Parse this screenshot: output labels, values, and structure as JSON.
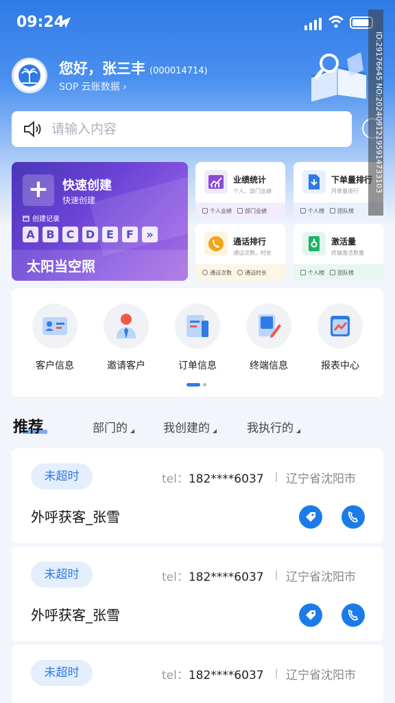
{
  "status_bar": {
    "time": "09:24"
  },
  "header": {
    "greeting": "您好，张三丰",
    "user_id": "(000014714)",
    "account_link": "SOP 云账数据 ›"
  },
  "search": {
    "placeholder": "请输入内容"
  },
  "quick_create": {
    "title": "快速创建",
    "subtitle": "快速创建",
    "record_label": "创建记录",
    "letters": [
      "A",
      "B",
      "C",
      "D",
      "E",
      "F",
      "»"
    ],
    "slogan": "太阳当空照"
  },
  "stat_cards": [
    {
      "title": "业绩统计",
      "sub": "个人、部门业绩",
      "foot": [
        "个人业绩",
        "部门业绩"
      ],
      "color": "#7b3fcf"
    },
    {
      "title": "下单量排行",
      "sub": "月单量排行",
      "foot": [
        "个人榜",
        "团队榜"
      ],
      "color": "#2f7ae6"
    },
    {
      "title": "通话排行",
      "sub": "通话次数、时长",
      "foot": [
        "通话次数",
        "通话时长"
      ],
      "color": "#f0a51a"
    },
    {
      "title": "激活量",
      "sub": "终端激活数量",
      "foot": [
        "个人榜",
        "团队榜"
      ],
      "color": "#1fb36a"
    }
  ],
  "menu": [
    {
      "label": "客户信息",
      "icon": "id-card-icon"
    },
    {
      "label": "邀请客户",
      "icon": "person-tie-icon"
    },
    {
      "label": "订单信息",
      "icon": "order-doc-icon"
    },
    {
      "label": "终端信息",
      "icon": "terminal-pen-icon"
    },
    {
      "label": "报表中心",
      "icon": "report-chart-icon"
    }
  ],
  "tabs": {
    "title": "推荐",
    "filters": [
      "部门的",
      "我创建的",
      "我执行的"
    ]
  },
  "list": [
    {
      "status": "未超时",
      "tel_label": "tel：",
      "tel": "182****6037",
      "region": "辽宁省沈阳市",
      "name": "外呼获客_张雪"
    },
    {
      "status": "未超时",
      "tel_label": "tel：",
      "tel": "182****6037",
      "region": "辽宁省沈阳市",
      "name": "外呼获客_张雪"
    },
    {
      "status": "未超时",
      "tel_label": "tel：",
      "tel": "182****6037",
      "region": "辽宁省沈阳市",
      "name": ""
    }
  ],
  "watermark": "ID:29176645 NO:20240912195914733103",
  "colors": {
    "primary": "#2f7ae6",
    "badge_bg": "#e4eefc"
  }
}
